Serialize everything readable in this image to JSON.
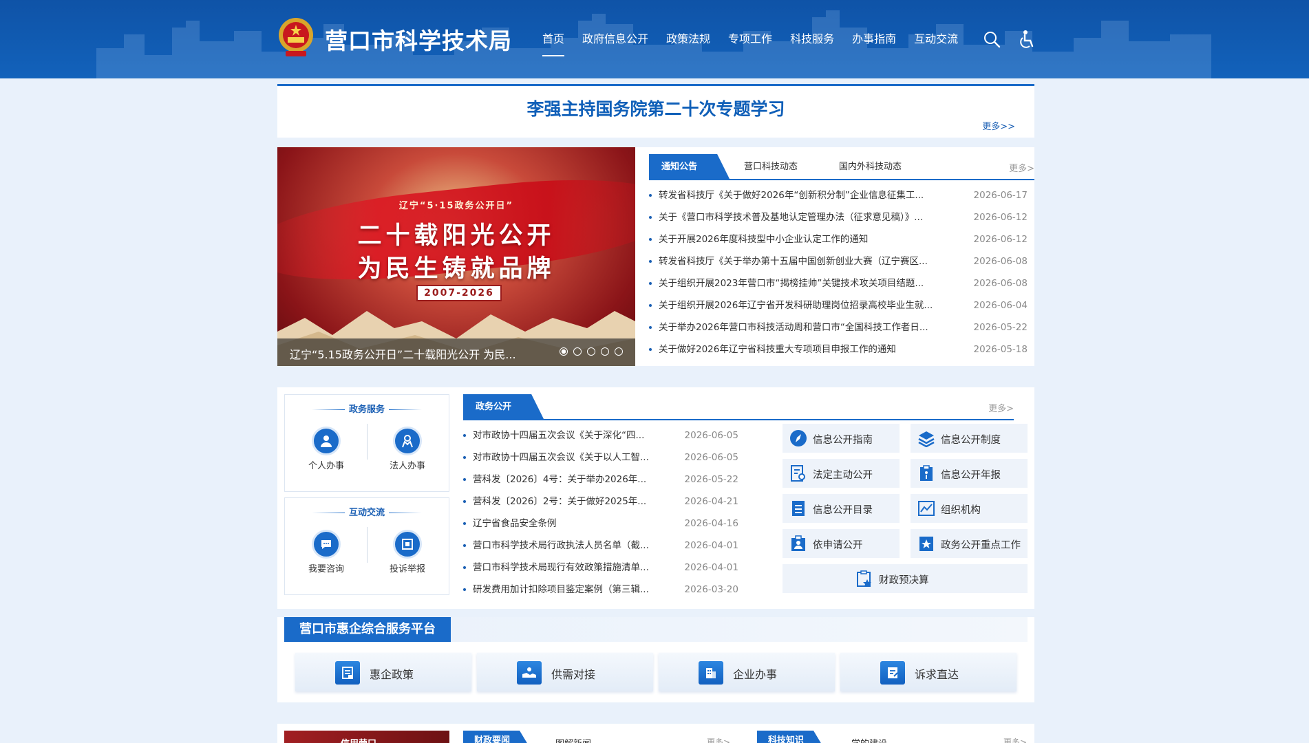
{
  "header": {
    "site_title": "营口市科学技术局",
    "nav": [
      {
        "label": "首页",
        "active": true
      },
      {
        "label": "政府信息公开"
      },
      {
        "label": "政策法规"
      },
      {
        "label": "专项工作"
      },
      {
        "label": "科技服务"
      },
      {
        "label": "办事指南"
      },
      {
        "label": "互动交流"
      }
    ],
    "icons": [
      "search-icon",
      "accessibility-icon"
    ],
    "accent_color": "#1262bb"
  },
  "headline": {
    "title": "李强主持国务院第二十次专题学习",
    "more": "更多>>"
  },
  "slideshow": {
    "kicker": "辽宁“5·15政务公开日”",
    "line1": "二十载阳光公开",
    "line2": "为民生铸就品牌",
    "years": "2007-2026",
    "caption": "辽宁“5.15政务公开日”二十载阳光公开 为民...",
    "dots": 5,
    "active_dot": 1
  },
  "notice": {
    "tabs": [
      "通知公告",
      "营口科技动态",
      "国内外科技动态"
    ],
    "more": "更多>",
    "items": [
      {
        "title": "转发省科技厅《关于做好2026年“创新积分制”企业信息征集工...",
        "date": "2026-06-17"
      },
      {
        "title": "关于《营口市科学技术普及基地认定管理办法（征求意见稿）》...",
        "date": "2026-06-12"
      },
      {
        "title": "关于开展2026年度科技型中小企业认定工作的通知",
        "date": "2026-06-12"
      },
      {
        "title": "转发省科技厅《关于举办第十五届中国创新创业大赛（辽宁赛区...",
        "date": "2026-06-08"
      },
      {
        "title": "关于组织开展2023年营口市“揭榜挂帅”关键技术攻关项目结题...",
        "date": "2026-06-08"
      },
      {
        "title": "关于组织开展2026年辽宁省开发科研助理岗位招录高校毕业生就...",
        "date": "2026-06-04"
      },
      {
        "title": "关于举办2026年营口市科技活动周和营口市“全国科技工作者日...",
        "date": "2026-05-22"
      },
      {
        "title": "关于做好2026年辽宁省科技重大专项项目申报工作的通知",
        "date": "2026-05-18"
      }
    ]
  },
  "services": {
    "gov_service": {
      "title": "政务服务",
      "buttons": [
        {
          "label": "个人办事",
          "icon": "person-icon"
        },
        {
          "label": "法人办事",
          "icon": "legal-person-icon"
        }
      ]
    },
    "interaction": {
      "title": "互动交流",
      "buttons": [
        {
          "label": "我要咨询",
          "icon": "chat-icon"
        },
        {
          "label": "投诉举报",
          "icon": "complaint-icon"
        }
      ]
    }
  },
  "gov_open": {
    "tab": "政务公开",
    "more": "更多>",
    "items": [
      {
        "title": "对市政协十四届五次会议《关于深化“四...",
        "date": "2026-06-05"
      },
      {
        "title": "对市政协十四届五次会议《关于以人工智...",
        "date": "2026-06-05"
      },
      {
        "title": "营科发〔2026〕4号：关于举办2026年...",
        "date": "2026-05-22"
      },
      {
        "title": "营科发〔2026〕2号：关于做好2025年...",
        "date": "2026-04-21"
      },
      {
        "title": "辽宁省食品安全条例",
        "date": "2026-04-16"
      },
      {
        "title": "营口市科学技术局行政执法人员名单（截...",
        "date": "2026-04-01"
      },
      {
        "title": "营口市科学技术局现行有效政策措施清单...",
        "date": "2026-04-01"
      },
      {
        "title": "研发费用加计扣除项目鉴定案例（第三辑...",
        "date": "2026-03-20"
      }
    ],
    "grid": [
      {
        "label": "信息公开指南",
        "icon": "compass-icon"
      },
      {
        "label": "信息公开制度",
        "icon": "layers-icon"
      },
      {
        "label": "法定主动公开",
        "icon": "document-search-icon"
      },
      {
        "label": "信息公开年报",
        "icon": "report-icon"
      },
      {
        "label": "信息公开目录",
        "icon": "list-icon"
      },
      {
        "label": "组织机构",
        "icon": "org-chart-icon"
      },
      {
        "label": "依申请公开",
        "icon": "apply-icon"
      },
      {
        "label": "政务公开重点工作",
        "icon": "star-icon"
      }
    ],
    "wide": {
      "label": "财政预决算",
      "icon": "budget-icon"
    }
  },
  "enterprise": {
    "title": "营口市惠企综合服务平台",
    "buttons": [
      {
        "label": "惠企政策",
        "icon": "policy-icon"
      },
      {
        "label": "供需对接",
        "icon": "handshake-icon"
      },
      {
        "label": "企业办事",
        "icon": "building-icon"
      },
      {
        "label": "诉求直达",
        "icon": "feedback-icon"
      }
    ]
  },
  "bottom": {
    "photo_text": "信用营口",
    "left_tab": "财政要闻",
    "left_tab2": "图解新闻",
    "left_more": "更多>",
    "right_tab": "科技知识",
    "right_tab2": "学的建设",
    "right_more": "更多>"
  }
}
